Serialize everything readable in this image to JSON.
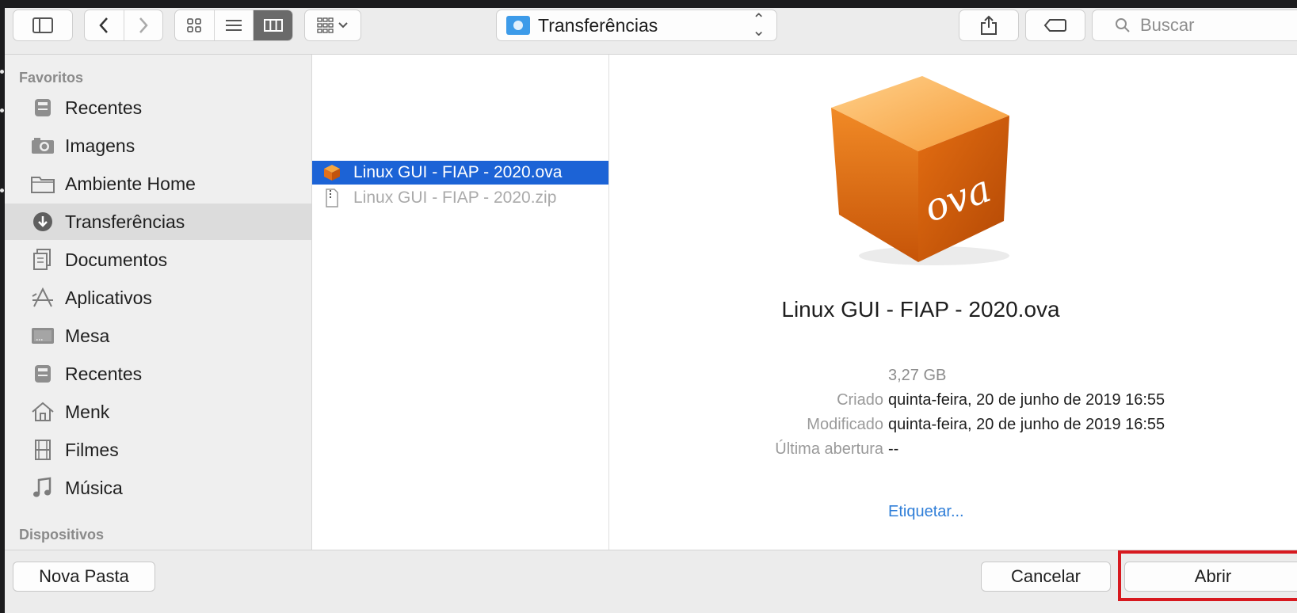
{
  "toolbar": {
    "location": "Transferências",
    "search_placeholder": "Buscar"
  },
  "sidebar": {
    "favorites_header": "Favoritos",
    "devices_header": "Dispositivos",
    "items": [
      {
        "label": "Recentes",
        "icon": "recents-icon"
      },
      {
        "label": "Imagens",
        "icon": "camera-icon"
      },
      {
        "label": "Ambiente Home",
        "icon": "folder-icon"
      },
      {
        "label": "Transferências",
        "icon": "download-icon",
        "selected": true
      },
      {
        "label": "Documentos",
        "icon": "documents-icon"
      },
      {
        "label": "Aplicativos",
        "icon": "applications-icon"
      },
      {
        "label": "Mesa",
        "icon": "desktop-icon"
      },
      {
        "label": "Recentes",
        "icon": "recents-icon"
      },
      {
        "label": "Menk",
        "icon": "home-icon"
      },
      {
        "label": "Filmes",
        "icon": "movies-icon"
      },
      {
        "label": "Música",
        "icon": "music-icon"
      }
    ]
  },
  "files": [
    {
      "name": "Linux GUI - FIAP - 2020.ova",
      "selected": true,
      "icon": "ova-package-icon"
    },
    {
      "name": "Linux GUI - FIAP - 2020.zip",
      "selected": false,
      "icon": "zip-file-icon"
    }
  ],
  "preview": {
    "icon_label": "ova",
    "filename": "Linux GUI - FIAP - 2020.ova",
    "size": "3,27 GB",
    "created_label": "Criado",
    "created_value": "quinta-feira, 20 de junho de 2019 16:55",
    "modified_label": "Modificado",
    "modified_value": "quinta-feira, 20 de junho de 2019 16:55",
    "opened_label": "Última abertura",
    "opened_value": "--",
    "tag_link": "Etiquetar..."
  },
  "buttons": {
    "new_folder": "Nova Pasta",
    "cancel": "Cancelar",
    "open": "Abrir"
  },
  "colors": {
    "selection": "#1c63d6",
    "highlight": "#d7191f",
    "link": "#2f7ed8"
  }
}
